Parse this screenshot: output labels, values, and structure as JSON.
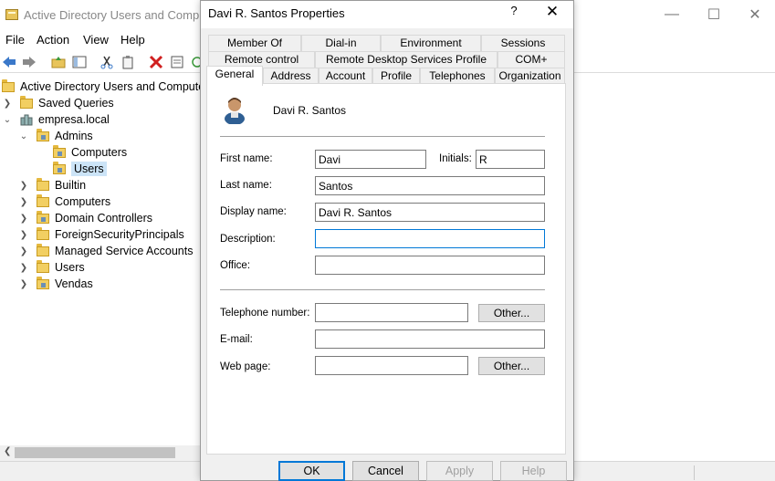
{
  "main_window": {
    "title": "Active Directory Users and Computers",
    "menu": [
      "File",
      "Action",
      "View",
      "Help"
    ],
    "tree": {
      "root": "Active Directory Users and Computers",
      "saved_queries": "Saved Queries",
      "domain": "empresa.local",
      "admins": "Admins",
      "admins_computers": "Computers",
      "admins_users": "Users",
      "builtin": "Builtin",
      "computers": "Computers",
      "domain_controllers": "Domain Controllers",
      "foreign": "ForeignSecurityPrincipals",
      "managed": "Managed Service Accounts",
      "users": "Users",
      "vendas": "Vendas"
    }
  },
  "dialog": {
    "title": "Davi R. Santos Properties",
    "help": "?",
    "tabs_row1": [
      "Member Of",
      "Dial-in",
      "Environment",
      "Sessions"
    ],
    "tabs_row2": [
      "Remote control",
      "Remote Desktop Services Profile",
      "COM+"
    ],
    "tabs_row3": [
      "General",
      "Address",
      "Account",
      "Profile",
      "Telephones",
      "Organization"
    ],
    "active_tab": "General",
    "user_display": "Davi R. Santos",
    "labels": {
      "first_name": "First name:",
      "initials": "Initials:",
      "last_name": "Last name:",
      "display_name": "Display name:",
      "description": "Description:",
      "office": "Office:",
      "telephone": "Telephone number:",
      "email": "E-mail:",
      "web_page": "Web page:"
    },
    "values": {
      "first_name": "Davi",
      "initials": "R",
      "last_name": "Santos",
      "display_name": "Davi R. Santos",
      "description": "",
      "office": "",
      "telephone": "",
      "email": "",
      "web_page": ""
    },
    "other_label": "Other...",
    "buttons": {
      "ok": "OK",
      "cancel": "Cancel",
      "apply": "Apply",
      "help": "Help"
    }
  },
  "colors": {
    "accent": "#0078d7",
    "folder": "#f2cf62",
    "selection": "#cce4f7"
  }
}
